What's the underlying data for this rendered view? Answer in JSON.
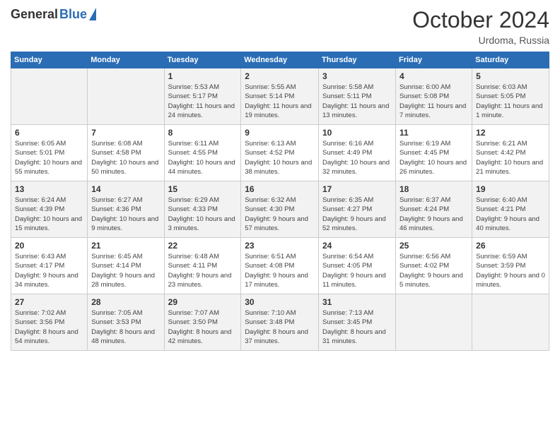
{
  "logo": {
    "general": "General",
    "blue": "Blue"
  },
  "header": {
    "month": "October 2024",
    "location": "Urdoma, Russia"
  },
  "weekdays": [
    "Sunday",
    "Monday",
    "Tuesday",
    "Wednesday",
    "Thursday",
    "Friday",
    "Saturday"
  ],
  "weeks": [
    [
      {
        "day": "",
        "info": ""
      },
      {
        "day": "",
        "info": ""
      },
      {
        "day": "1",
        "info": "Sunrise: 5:53 AM\nSunset: 5:17 PM\nDaylight: 11 hours and 24 minutes."
      },
      {
        "day": "2",
        "info": "Sunrise: 5:55 AM\nSunset: 5:14 PM\nDaylight: 11 hours and 19 minutes."
      },
      {
        "day": "3",
        "info": "Sunrise: 5:58 AM\nSunset: 5:11 PM\nDaylight: 11 hours and 13 minutes."
      },
      {
        "day": "4",
        "info": "Sunrise: 6:00 AM\nSunset: 5:08 PM\nDaylight: 11 hours and 7 minutes."
      },
      {
        "day": "5",
        "info": "Sunrise: 6:03 AM\nSunset: 5:05 PM\nDaylight: 11 hours and 1 minute."
      }
    ],
    [
      {
        "day": "6",
        "info": "Sunrise: 6:05 AM\nSunset: 5:01 PM\nDaylight: 10 hours and 55 minutes."
      },
      {
        "day": "7",
        "info": "Sunrise: 6:08 AM\nSunset: 4:58 PM\nDaylight: 10 hours and 50 minutes."
      },
      {
        "day": "8",
        "info": "Sunrise: 6:11 AM\nSunset: 4:55 PM\nDaylight: 10 hours and 44 minutes."
      },
      {
        "day": "9",
        "info": "Sunrise: 6:13 AM\nSunset: 4:52 PM\nDaylight: 10 hours and 38 minutes."
      },
      {
        "day": "10",
        "info": "Sunrise: 6:16 AM\nSunset: 4:49 PM\nDaylight: 10 hours and 32 minutes."
      },
      {
        "day": "11",
        "info": "Sunrise: 6:19 AM\nSunset: 4:45 PM\nDaylight: 10 hours and 26 minutes."
      },
      {
        "day": "12",
        "info": "Sunrise: 6:21 AM\nSunset: 4:42 PM\nDaylight: 10 hours and 21 minutes."
      }
    ],
    [
      {
        "day": "13",
        "info": "Sunrise: 6:24 AM\nSunset: 4:39 PM\nDaylight: 10 hours and 15 minutes."
      },
      {
        "day": "14",
        "info": "Sunrise: 6:27 AM\nSunset: 4:36 PM\nDaylight: 10 hours and 9 minutes."
      },
      {
        "day": "15",
        "info": "Sunrise: 6:29 AM\nSunset: 4:33 PM\nDaylight: 10 hours and 3 minutes."
      },
      {
        "day": "16",
        "info": "Sunrise: 6:32 AM\nSunset: 4:30 PM\nDaylight: 9 hours and 57 minutes."
      },
      {
        "day": "17",
        "info": "Sunrise: 6:35 AM\nSunset: 4:27 PM\nDaylight: 9 hours and 52 minutes."
      },
      {
        "day": "18",
        "info": "Sunrise: 6:37 AM\nSunset: 4:24 PM\nDaylight: 9 hours and 46 minutes."
      },
      {
        "day": "19",
        "info": "Sunrise: 6:40 AM\nSunset: 4:21 PM\nDaylight: 9 hours and 40 minutes."
      }
    ],
    [
      {
        "day": "20",
        "info": "Sunrise: 6:43 AM\nSunset: 4:17 PM\nDaylight: 9 hours and 34 minutes."
      },
      {
        "day": "21",
        "info": "Sunrise: 6:45 AM\nSunset: 4:14 PM\nDaylight: 9 hours and 28 minutes."
      },
      {
        "day": "22",
        "info": "Sunrise: 6:48 AM\nSunset: 4:11 PM\nDaylight: 9 hours and 23 minutes."
      },
      {
        "day": "23",
        "info": "Sunrise: 6:51 AM\nSunset: 4:08 PM\nDaylight: 9 hours and 17 minutes."
      },
      {
        "day": "24",
        "info": "Sunrise: 6:54 AM\nSunset: 4:05 PM\nDaylight: 9 hours and 11 minutes."
      },
      {
        "day": "25",
        "info": "Sunrise: 6:56 AM\nSunset: 4:02 PM\nDaylight: 9 hours and 5 minutes."
      },
      {
        "day": "26",
        "info": "Sunrise: 6:59 AM\nSunset: 3:59 PM\nDaylight: 9 hours and 0 minutes."
      }
    ],
    [
      {
        "day": "27",
        "info": "Sunrise: 7:02 AM\nSunset: 3:56 PM\nDaylight: 8 hours and 54 minutes."
      },
      {
        "day": "28",
        "info": "Sunrise: 7:05 AM\nSunset: 3:53 PM\nDaylight: 8 hours and 48 minutes."
      },
      {
        "day": "29",
        "info": "Sunrise: 7:07 AM\nSunset: 3:50 PM\nDaylight: 8 hours and 42 minutes."
      },
      {
        "day": "30",
        "info": "Sunrise: 7:10 AM\nSunset: 3:48 PM\nDaylight: 8 hours and 37 minutes."
      },
      {
        "day": "31",
        "info": "Sunrise: 7:13 AM\nSunset: 3:45 PM\nDaylight: 8 hours and 31 minutes."
      },
      {
        "day": "",
        "info": ""
      },
      {
        "day": "",
        "info": ""
      }
    ]
  ]
}
